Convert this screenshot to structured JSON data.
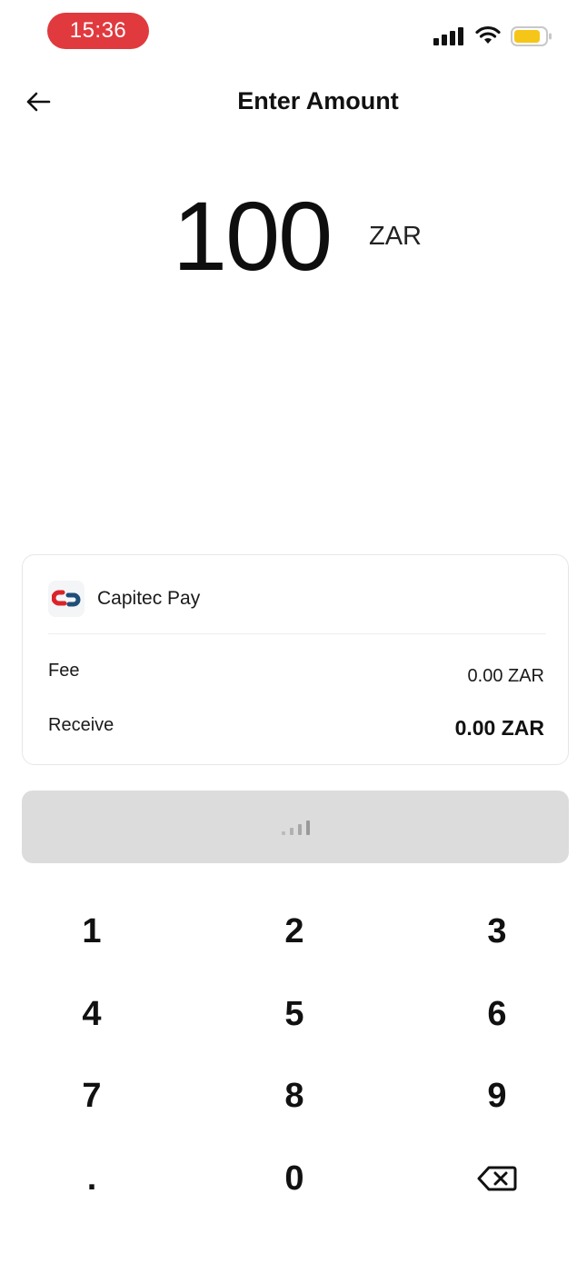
{
  "status_bar": {
    "time": "15:36"
  },
  "header": {
    "title": "Enter Amount"
  },
  "amount": {
    "value": "100",
    "currency": "ZAR"
  },
  "payment_card": {
    "method_name": "Capitec Pay",
    "fee_label": "Fee",
    "fee_value": "0.00 ZAR",
    "receive_label": "Receive",
    "receive_value": "0.00 ZAR"
  },
  "keypad": {
    "keys": [
      "1",
      "2",
      "3",
      "4",
      "5",
      "6",
      "7",
      "8",
      "9",
      ".",
      "0"
    ]
  },
  "colors": {
    "time_pill": "#e03a3e",
    "battery": "#f5c518",
    "button_disabled": "#dcdcdc",
    "logo_red": "#d9252a",
    "logo_blue": "#1f4e79"
  },
  "icons": [
    "back-arrow-icon",
    "signal-icon",
    "wifi-icon",
    "battery-icon",
    "capitec-logo-icon",
    "loading-bars-icon",
    "backspace-icon"
  ]
}
